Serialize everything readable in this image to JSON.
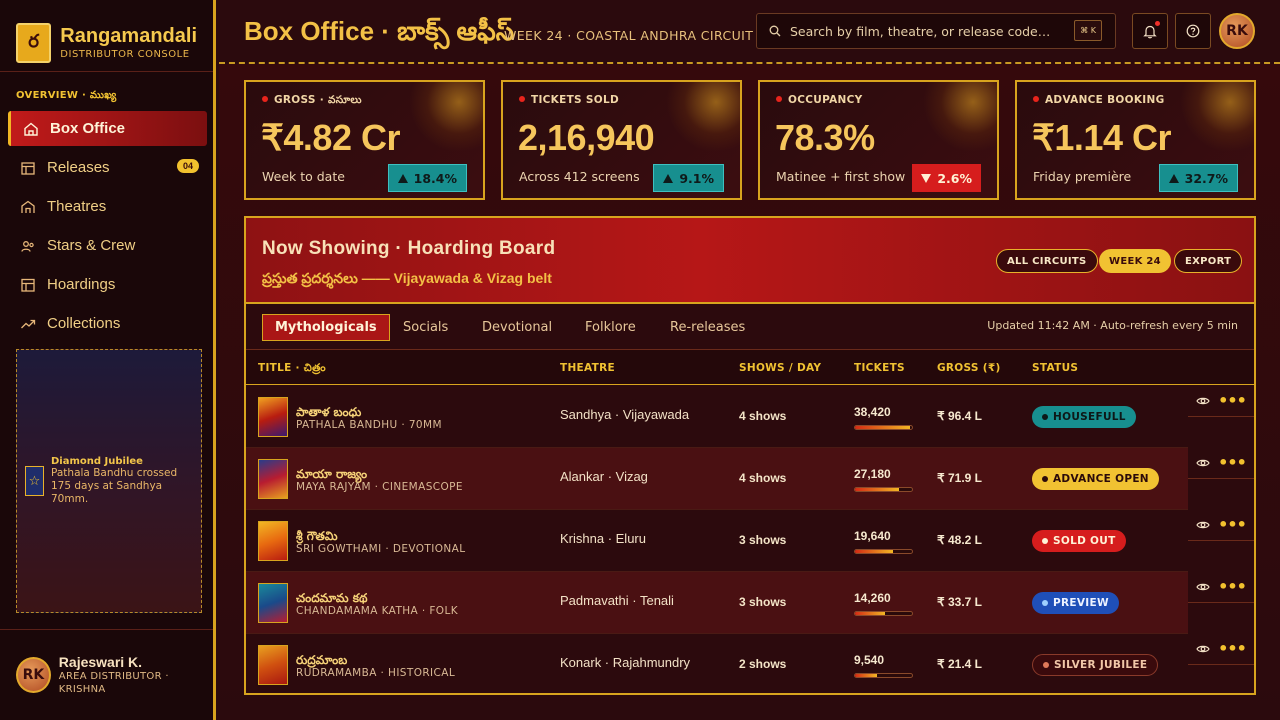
{
  "brand": {
    "logo_char": "ర",
    "name": "Rangamandali",
    "subtitle": "DISTRIBUTOR CONSOLE"
  },
  "sidebar": {
    "section": "OVERVIEW · ముఖ్య",
    "items": [
      {
        "label": "Box Office",
        "icon": "home-icon",
        "active": true
      },
      {
        "label": "Releases",
        "icon": "calendar-icon",
        "badge": "04"
      },
      {
        "label": "Theatres",
        "icon": "building-icon"
      },
      {
        "label": "Stars & Crew",
        "icon": "people-icon"
      },
      {
        "label": "Hoardings",
        "icon": "grid-icon"
      },
      {
        "label": "Collections",
        "icon": "trend-up-icon"
      }
    ],
    "promo": {
      "title": "Diamond Jubilee",
      "text": "Pathala Bandhu crossed 175 days at Sandhya 70mm."
    },
    "user": {
      "initials": "RK",
      "name": "Rajeswari K.",
      "role": "AREA DISTRIBUTOR · KRISHNA"
    }
  },
  "header": {
    "title": "Box Office · బాక్స్ ఆఫీస్",
    "subtitle": "WEEK 24 · COASTAL ANDHRA CIRCUIT",
    "search_placeholder": "Search by film, theatre, or release code…",
    "search_shortcut": "⌘ K",
    "avatar_initials": "RK"
  },
  "stats": [
    {
      "label": "GROSS · వసూలు",
      "value": "₹4.82 Cr",
      "note": "Week to date",
      "delta": "18.4%",
      "direction": "up"
    },
    {
      "label": "TICKETS SOLD",
      "value": "2,16,940",
      "note": "Across 412 screens",
      "delta": "9.1%",
      "direction": "up"
    },
    {
      "label": "OCCUPANCY",
      "value": "78.3%",
      "note": "Matinee + first show",
      "delta": "2.6%",
      "direction": "down"
    },
    {
      "label": "ADVANCE BOOKING",
      "value": "₹1.14 Cr",
      "note": "Friday première",
      "delta": "32.7%",
      "direction": "up"
    }
  ],
  "board": {
    "title": "Now Showing · Hoarding Board",
    "subtitle": "ప్రస్తుత ప్రదర్శనలు —— Vijayawada & Vizag belt",
    "filters": [
      "ALL CIRCUITS",
      "WEEK 24",
      "EXPORT"
    ],
    "tabs": [
      "Mythologicals",
      "Socials",
      "Devotional",
      "Folklore",
      "Re-releases"
    ],
    "updated": "Updated 11:42 AM · Auto-refresh every 5 min",
    "columns": [
      "TITLE · చిత్రం",
      "THEATRE",
      "SHOWS / DAY",
      "TICKETS",
      "GROSS (₹)",
      "STATUS"
    ],
    "rows": [
      {
        "title_te": "పాతాళ బంధు",
        "title_en": "PATHALA BANDHU · 70MM",
        "theatre": "Sandhya · Vijayawada",
        "shows": "4 shows",
        "tickets": "38,420",
        "fill": 0.97,
        "gross": "₹ 96.4 L",
        "status": "HOUSEFULL",
        "status_bg": "#178f8f",
        "status_fg": "#0d1818",
        "status_dot": "#0d1818",
        "poster": [
          "#f0a020",
          "#b81c10",
          "#3a1a70"
        ]
      },
      {
        "title_te": "మాయా రాజ్యం",
        "title_en": "MAYA RAJYAM · CINEMASCOPE",
        "theatre": "Alankar · Vizag",
        "shows": "4 shows",
        "tickets": "27,180",
        "fill": 0.78,
        "gross": "₹ 71.9 L",
        "status": "ADVANCE OPEN",
        "status_bg": "#f1c232",
        "status_fg": "#2a0a0a",
        "status_dot": "#2a0a0a",
        "poster": [
          "#2a3c8a",
          "#b81c30",
          "#e8a020"
        ]
      },
      {
        "title_te": "శ్రీ గౌతమి",
        "title_en": "SRI GOWTHAMI · DEVOTIONAL",
        "theatre": "Krishna · Eluru",
        "shows": "3 shows",
        "tickets": "19,640",
        "fill": 0.66,
        "gross": "₹ 48.2 L",
        "status": "SOLD OUT",
        "status_bg": "#d61d1d",
        "status_fg": "#fff3d8",
        "status_dot": "#fff3d8",
        "poster": [
          "#f2b724",
          "#e86a10",
          "#b81c10"
        ]
      },
      {
        "title_te": "చందమామ కథ",
        "title_en": "CHANDAMAMA KATHA · FOLK",
        "theatre": "Padmavathi · Tenali",
        "shows": "3 shows",
        "tickets": "14,260",
        "fill": 0.52,
        "gross": "₹ 33.7 L",
        "status": "PREVIEW",
        "status_bg": "#1f4fb8",
        "status_fg": "#eef3ff",
        "status_dot": "#9fd0ff",
        "poster": [
          "#1a8a9a",
          "#1a4a8a",
          "#b81c30"
        ]
      },
      {
        "title_te": "రుద్రమాంబ",
        "title_en": "RUDRAMAMBA · HISTORICAL",
        "theatre": "Konark · Rajahmundry",
        "shows": "2 shows",
        "tickets": "9,540",
        "fill": 0.38,
        "gross": "₹ 21.4 L",
        "status": "SILVER JUBILEE",
        "status_bg": "#3a0a0c",
        "status_fg": "#f1c7a8",
        "status_dot": "#e07a5a",
        "status_border": "#8a3a2a",
        "poster": [
          "#e8a020",
          "#d05010",
          "#a81810"
        ]
      }
    ]
  }
}
